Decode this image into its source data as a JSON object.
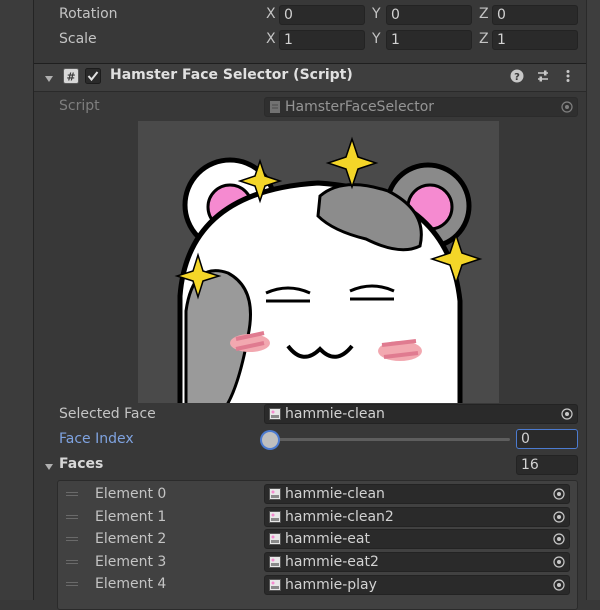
{
  "transform": {
    "rotation": {
      "label": "Rotation",
      "x": "0",
      "y": "0",
      "z": "0"
    },
    "scale": {
      "label": "Scale",
      "x": "1",
      "y": "1",
      "z": "1"
    },
    "axes": {
      "x": "X",
      "y": "Y",
      "z": "Z"
    }
  },
  "component": {
    "title": "Hamster Face Selector (Script)",
    "enabled": true,
    "script_label": "Script",
    "script_value": "HamsterFaceSelector"
  },
  "preview": {
    "icon": "hamster-face-preview"
  },
  "selected_face": {
    "label": "Selected Face",
    "value": "hammie-clean"
  },
  "face_index": {
    "label": "Face Index",
    "value": "0",
    "slider_fraction": 0.0
  },
  "faces": {
    "label": "Faces",
    "count": "16",
    "elements": [
      {
        "label": "Element 0",
        "value": "hammie-clean"
      },
      {
        "label": "Element 1",
        "value": "hammie-clean2"
      },
      {
        "label": "Element 2",
        "value": "hammie-eat"
      },
      {
        "label": "Element 3",
        "value": "hammie-eat2"
      },
      {
        "label": "Element 4",
        "value": "hammie-play"
      }
    ]
  },
  "colors": {
    "accent": "#4c7bd0",
    "slider_knob": "#bfbfbf",
    "link_label": "#7fa3e0"
  }
}
